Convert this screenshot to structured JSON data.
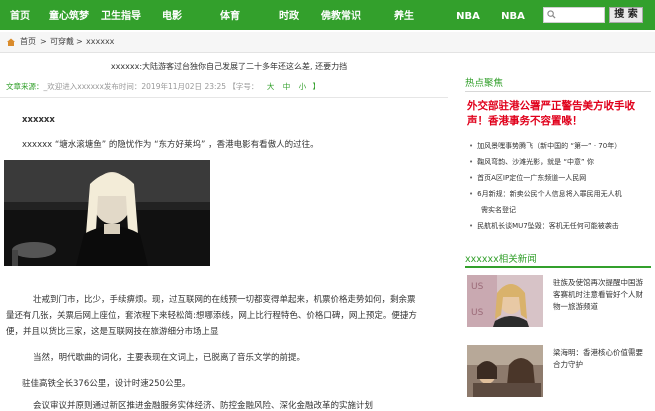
{
  "nav": {
    "items": [
      {
        "label": "首页"
      },
      {
        "label": "童心筑梦"
      },
      {
        "label": "卫生指导"
      },
      {
        "label": "电影"
      },
      {
        "label": "体育"
      },
      {
        "label": "时政"
      },
      {
        "label": "佛教常识"
      },
      {
        "label": "养生"
      },
      {
        "label": "NBA"
      },
      {
        "label": "NBA"
      }
    ],
    "search_placeholder": "",
    "search_button": "搜 索"
  },
  "breadcrumb": {
    "home": "首页",
    "sep1": ">",
    "level1": "可穿戴",
    "sep2": ">",
    "level2": "xxxxxx"
  },
  "article": {
    "title": "xxxxxx:大陆游客过台独你自己发展了二十多年还这么差, 还要力挡",
    "source_label": "文章来源：",
    "source_value": "_欢迎进入xxxxxx发布时间：2019年11月02日 23:25 【字号：",
    "size_big": "大",
    "size_mid": "中",
    "size_small": "小",
    "size_close": "】",
    "lead": "xxxxxx",
    "p1": "xxxxxx “塘水滚塘鱼” 的隐忧作为 “东方好莱坞” ，香港电影有看傲人的过往。",
    "p2a": "壮戒到门市，比少，手续痹烦。现，过互联网的在线预一切都变得单起来，机票价格走势如何，剩余票",
    "p2b": "量还有几张，关票后网上座位，套浓程下来轻松简:想哪添线，网上比行程特色、价格口碑，网上预定。便捷方",
    "p2c": "便，并且以货比三家，这是互联网技在旅游细分市场上显",
    "p3": "当然，明代歇曲的词化，主要表现在文词上，已脱离了音乐文学的前提。",
    "p4": "驻佳高铁全长376公里，设计时速250公里。",
    "p5": "会议审议并原则通过新区推进金融服务实体经济、防控金融风险、深化金融改革的实施计划"
  },
  "sidebar": {
    "hot_title": "热点聚焦",
    "headline": "外交部驻港公署严正警告美方收手收声！香港事务不容置喙！",
    "hot_items": [
      "加风景嘿事势腾飞（新中国的 “第一” · 70年）",
      "鞠风弯韵、沙滩光影，就是 “中意” 你",
      "首页A区IP定位一广东频道一人民网",
      "6月新规：新卖公民个人信息将入罪民用无人机",
      "需实名登记",
      "民航机长谈MU7坠毁：客机无任何可能被袭击"
    ],
    "related_title": "xxxxxx相关新闻",
    "related": [
      {
        "text": "驻族及使馆再次提醒中国游客赛机时注意看管好个人财物一旅游频道"
      },
      {
        "text": "梁海明：香港核心价值需要合力守护"
      }
    ]
  }
}
